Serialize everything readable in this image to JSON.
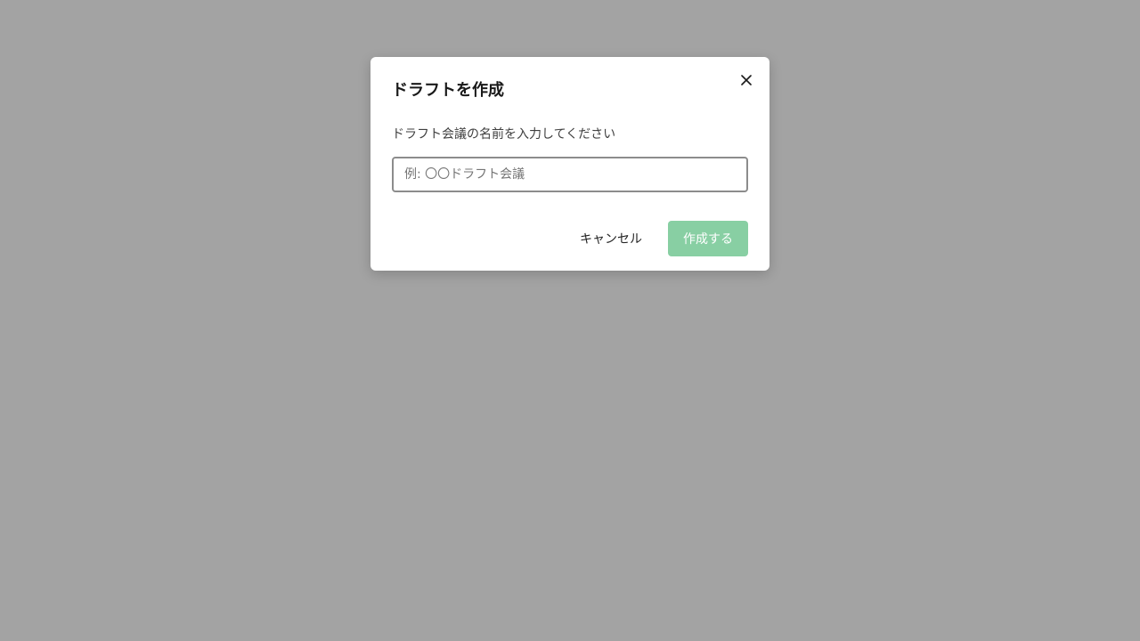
{
  "dialog": {
    "title": "ドラフトを作成",
    "prompt": "ドラフト会議の名前を入力してください",
    "input": {
      "value": "",
      "placeholder": "例: 〇〇ドラフト会議"
    },
    "cancel_label": "キャンセル",
    "create_label": "作成する",
    "create_enabled": false,
    "close_icon": "close-icon"
  },
  "colors": {
    "backdrop": "#a3a3a3",
    "primary_disabled": "#88cfa3",
    "input_border": "#8c8c8c"
  }
}
